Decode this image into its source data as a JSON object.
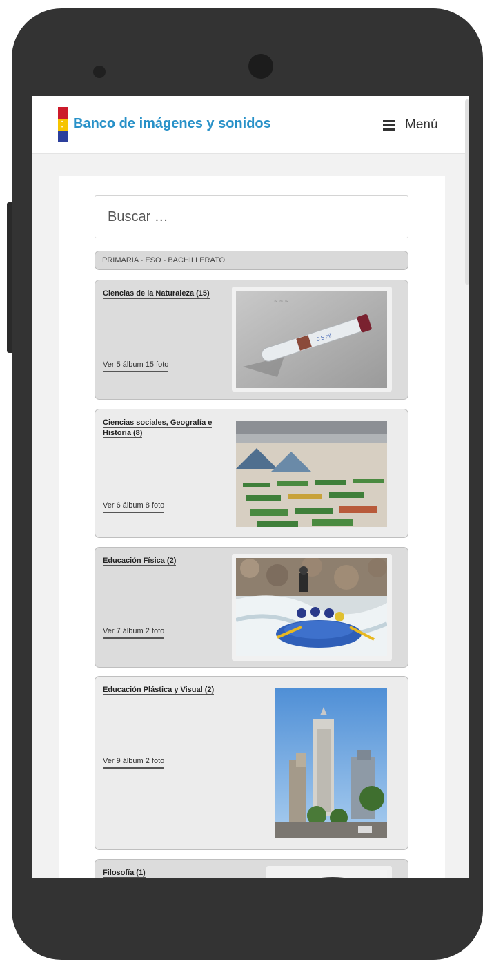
{
  "header": {
    "site_title": "Banco de imágenes y sonidos",
    "menu_label": "Menú"
  },
  "search": {
    "placeholder": "Buscar …"
  },
  "level_bar": {
    "label": "PRIMARIA - ESO - BACHILLERATO"
  },
  "categories": [
    {
      "title": "Ciencias de la Naturaleza (15)",
      "link": "Ver 5 álbum 15 foto",
      "image": "test-tube-photo"
    },
    {
      "title_line1": "Ciencias sociales, Geografía e",
      "title_line2": "Historia (8)",
      "link": "Ver 6 álbum 8 foto",
      "image": "plaza-garden-photo"
    },
    {
      "title": "Educación Física (2)",
      "link": "Ver 7 álbum 2 foto",
      "image": "rafting-photo"
    },
    {
      "title": "Educación Plástica y Visual (2)",
      "link": "Ver 9 álbum 2 foto",
      "image": "skyscraper-photo"
    },
    {
      "title": "Filosofía (1)",
      "image": "portrait-photo"
    }
  ],
  "colors": {
    "brand_blue": "#2891c8",
    "phone_body": "#333333",
    "flag_red": "#cc1b2b",
    "flag_yellow": "#f6c400",
    "flag_blue": "#2c3f9c"
  }
}
